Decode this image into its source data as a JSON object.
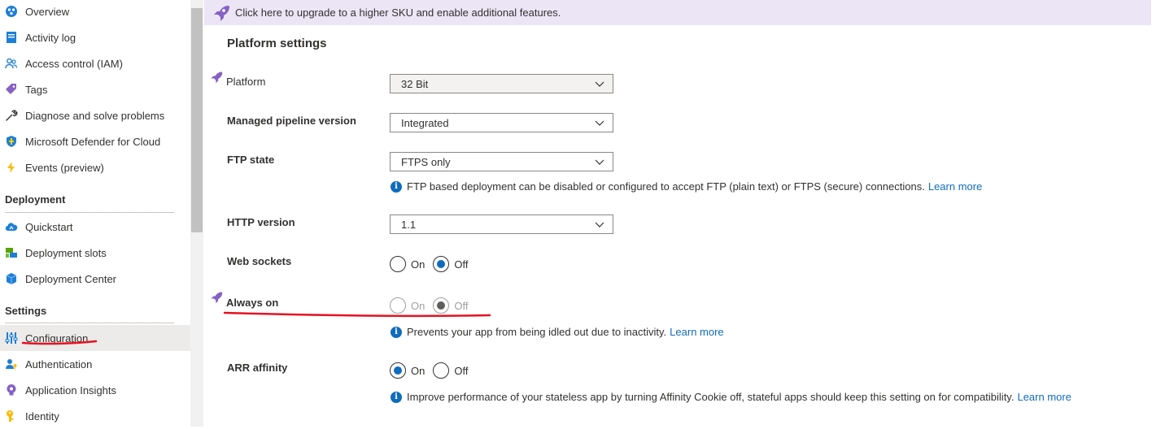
{
  "sidebar": {
    "items": [
      {
        "label": "Overview",
        "icon": "overview-icon"
      },
      {
        "label": "Activity log",
        "icon": "activity-log-icon"
      },
      {
        "label": "Access control (IAM)",
        "icon": "people-icon"
      },
      {
        "label": "Tags",
        "icon": "tag-icon"
      },
      {
        "label": "Diagnose and solve problems",
        "icon": "wrench-icon"
      },
      {
        "label": "Microsoft Defender for Cloud",
        "icon": "shield-icon"
      },
      {
        "label": "Events (preview)",
        "icon": "lightning-icon"
      }
    ],
    "deployment": {
      "header": "Deployment",
      "items": [
        {
          "label": "Quickstart",
          "icon": "cloud-icon"
        },
        {
          "label": "Deployment slots",
          "icon": "slots-icon"
        },
        {
          "label": "Deployment Center",
          "icon": "cube-icon"
        }
      ]
    },
    "settings": {
      "header": "Settings",
      "items": [
        {
          "label": "Configuration",
          "icon": "sliders-icon",
          "selected": true
        },
        {
          "label": "Authentication",
          "icon": "person-key-icon"
        },
        {
          "label": "Application Insights",
          "icon": "lightbulb-icon"
        },
        {
          "label": "Identity",
          "icon": "key-icon"
        }
      ]
    }
  },
  "banner": {
    "text": "Click here to upgrade to a higher SKU and enable additional features."
  },
  "main": {
    "title": "Platform settings",
    "platform": {
      "label": "Platform",
      "value": "32 Bit"
    },
    "pipeline": {
      "label": "Managed pipeline version",
      "value": "Integrated"
    },
    "ftp": {
      "label": "FTP state",
      "value": "FTPS only",
      "info": "FTP based deployment can be disabled or configured to accept FTP (plain text) or FTPS (secure) connections.",
      "link": "Learn more"
    },
    "http": {
      "label": "HTTP version",
      "value": "1.1"
    },
    "websockets": {
      "label": "Web sockets",
      "on": "On",
      "off": "Off",
      "selected": "Off"
    },
    "alwayson": {
      "label": "Always on",
      "on": "On",
      "off": "Off",
      "selected": "Off",
      "disabled": true,
      "info": "Prevents your app from being idled out due to inactivity.",
      "link": "Learn more"
    },
    "arr": {
      "label": "ARR affinity",
      "on": "On",
      "off": "Off",
      "selected": "On",
      "info": "Improve performance of your stateless app by turning Affinity Cookie off, stateful apps should keep this setting on for compatibility.",
      "link": "Learn more"
    }
  },
  "colors": {
    "accent": "#0f6cbd",
    "banner_bg": "#ece5f6",
    "annotation": "#e81123",
    "premium": "#8661c5"
  }
}
